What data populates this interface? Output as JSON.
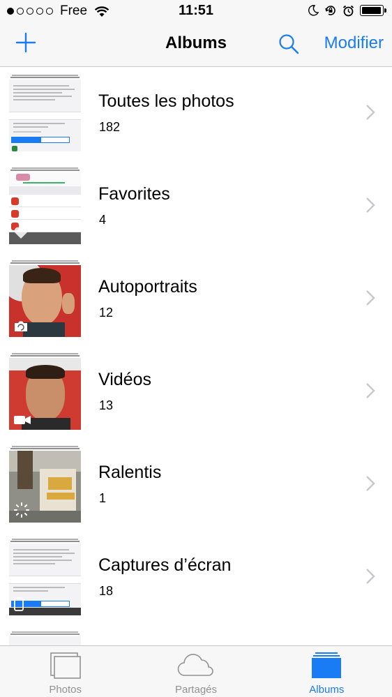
{
  "status_bar": {
    "carrier": "Free",
    "time": "11:51",
    "signal_bars_filled": 1,
    "signal_bars_total": 5,
    "battery_level": 0.95
  },
  "nav": {
    "add_icon": "plus-icon",
    "title": "Albums",
    "search_icon": "search-icon",
    "edit_label": "Modifier"
  },
  "albums": [
    {
      "name": "Toutes les photos",
      "count": "182",
      "thumb": "screenshot"
    },
    {
      "name": "Favorites",
      "count": "4",
      "thumb": "fitness"
    },
    {
      "name": "Autoportraits",
      "count": "12",
      "thumb": "selfie",
      "badge_icon": "selfie-camera-icon"
    },
    {
      "name": "Vidéos",
      "count": "13",
      "thumb": "video",
      "badge_icon": "video-camera-icon"
    },
    {
      "name": "Ralentis",
      "count": "1",
      "thumb": "room",
      "badge_icon": "slow-motion-icon"
    },
    {
      "name": "Captures d’écran",
      "count": "18",
      "thumb": "screenshot"
    }
  ],
  "tabbar": {
    "tabs": [
      {
        "label": "Photos",
        "icon": "photos-stack-icon",
        "active": false
      },
      {
        "label": "Partagés",
        "icon": "cloud-icon",
        "active": false
      },
      {
        "label": "Albums",
        "icon": "albums-icon",
        "active": true
      }
    ]
  },
  "colors": {
    "accent": "#1a7cf4",
    "inactive_tab": "#929292",
    "bar_background": "#f7f7f7"
  }
}
